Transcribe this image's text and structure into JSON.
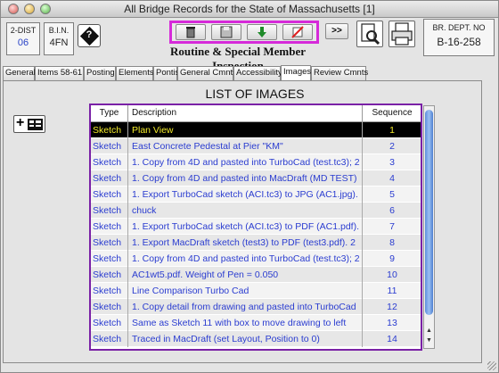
{
  "window": {
    "title": "All Bridge Records for the State of Massachusetts [1]"
  },
  "header": {
    "dist_label": "2-DIST",
    "dist_value": "06",
    "bin_label": "B.I.N.",
    "bin_value": "4FN",
    "br_dept_label": "BR. DEPT. NO",
    "br_dept_value": "B-16-258",
    "inspection_title": "Routine & Special Member Inspection",
    "next_button_label": ">>"
  },
  "toolbar": {
    "icons": [
      "trash-icon",
      "save-icon",
      "download-icon",
      "edit-disabled-icon"
    ],
    "highlight_color": "#d62ad9"
  },
  "tabs": [
    {
      "label": "General",
      "active": false
    },
    {
      "label": "Items 58-61",
      "active": false
    },
    {
      "label": "Posting",
      "active": false
    },
    {
      "label": "Elements",
      "active": false
    },
    {
      "label": "Pontis",
      "active": false
    },
    {
      "label": "General Cmnts",
      "active": false
    },
    {
      "label": "Accessibility",
      "active": false
    },
    {
      "label": "Images",
      "active": true
    },
    {
      "label": "Review Cmnts",
      "active": false
    }
  ],
  "images": {
    "title": "LIST OF IMAGES",
    "columns": {
      "type": "Type",
      "description": "Description",
      "sequence": "Sequence"
    },
    "rows": [
      {
        "type": "Sketch",
        "description": "Plan View",
        "sequence": "1",
        "selected": true
      },
      {
        "type": "Sketch",
        "description": "East Concrete Pedestal at Pier \"KM\"",
        "sequence": "2"
      },
      {
        "type": "Sketch",
        "description": "1. Copy from 4D and pasted into TurboCad (test.tc3); 2",
        "sequence": "3"
      },
      {
        "type": "Sketch",
        "description": "1. Copy from 4D and pasted into MacDraft (MD TEST)",
        "sequence": "4"
      },
      {
        "type": "Sketch",
        "description": "1. Export TurboCad sketch (ACI.tc3) to JPG (AC1.jpg).",
        "sequence": "5"
      },
      {
        "type": "Sketch",
        "description": "chuck",
        "sequence": "6"
      },
      {
        "type": "Sketch",
        "description": "1. Export TurboCad sketch (ACI.tc3) to PDF (AC1.pdf).",
        "sequence": "7"
      },
      {
        "type": "Sketch",
        "description": "1. Export MacDraft sketch (test3) to PDF (test3.pdf).  2",
        "sequence": "8"
      },
      {
        "type": "Sketch",
        "description": "1. Copy from 4D and pasted into TurboCad (test.tc3); 2",
        "sequence": "9"
      },
      {
        "type": "Sketch",
        "description": "AC1wt5.pdf.  Weight of Pen = 0.050",
        "sequence": "10"
      },
      {
        "type": "Sketch",
        "description": "Line Comparison Turbo Cad",
        "sequence": "11"
      },
      {
        "type": "Sketch",
        "description": "1. Copy detail from drawing and pasted into TurboCad",
        "sequence": "12"
      },
      {
        "type": "Sketch",
        "description": "Same as Sketch 11 with box to move drawing to left",
        "sequence": "13"
      },
      {
        "type": "Sketch",
        "description": "Traced in MacDraft (set Layout, Position to 0)",
        "sequence": "14"
      }
    ]
  },
  "colors": {
    "row_text": "#2a3cd0",
    "selected_bg": "#000000",
    "selected_text": "#f2ea2a",
    "table_border": "#7a21a6"
  }
}
